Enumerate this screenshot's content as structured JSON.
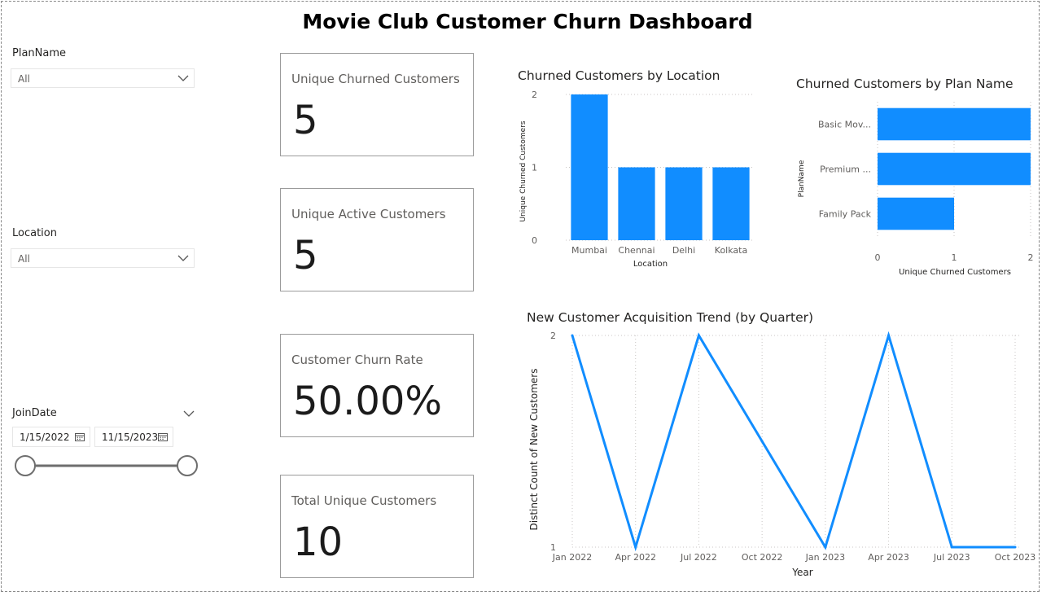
{
  "title": "Movie Club Customer Churn Dashboard",
  "slicers": {
    "plan": {
      "label": "PlanName",
      "value": "All"
    },
    "location": {
      "label": "Location",
      "value": "All"
    },
    "joindate": {
      "label": "JoinDate",
      "start": "1/15/2022",
      "end": "11/15/2023"
    }
  },
  "cards": [
    {
      "label": "Unique Churned Customers",
      "value": "5"
    },
    {
      "label": "Unique Active Customers",
      "value": "5"
    },
    {
      "label": "Customer Churn Rate",
      "value": "50.00%"
    },
    {
      "label": "Total Unique Customers",
      "value": "10"
    }
  ],
  "colors": {
    "bar": "#118dff",
    "line": "#118dff",
    "grid": "#c8c6c4"
  },
  "chart_data": [
    {
      "type": "bar",
      "title": "Churned Customers by Location",
      "categories": [
        "Mumbai",
        "Chennai",
        "Delhi",
        "Kolkata"
      ],
      "values": [
        2,
        1,
        1,
        1
      ],
      "xlabel": "Location",
      "ylabel": "Unique Churned Customers",
      "ylim": [
        0,
        2
      ],
      "yticks": [
        "0",
        "1",
        "2"
      ],
      "grid": true
    },
    {
      "type": "bar",
      "orientation": "horizontal",
      "title": "Churned Customers by Plan Name",
      "categories": [
        "Basic Mov...",
        "Premium ...",
        "Family Pack"
      ],
      "values": [
        2,
        2,
        1
      ],
      "xlabel": "Unique Churned Customers",
      "ylabel": "PlanName",
      "xlim": [
        0,
        2
      ],
      "xticks": [
        "0",
        "1",
        "2"
      ],
      "grid": true
    },
    {
      "type": "line",
      "title": "New Customer Acquisition Trend (by Quarter)",
      "x": [
        "Jan 2022",
        "Apr 2022",
        "Jul 2022",
        "Oct 2022",
        "Jan 2023",
        "Apr 2023",
        "Jul 2023",
        "Oct 2023"
      ],
      "values": [
        2,
        1,
        2,
        1.5,
        1,
        2,
        1,
        1
      ],
      "xlabel": "Year",
      "ylabel": "Distinct Count of New Customers",
      "ylim": [
        1,
        2
      ],
      "yticks": [
        "1",
        "2"
      ],
      "grid": true
    }
  ]
}
